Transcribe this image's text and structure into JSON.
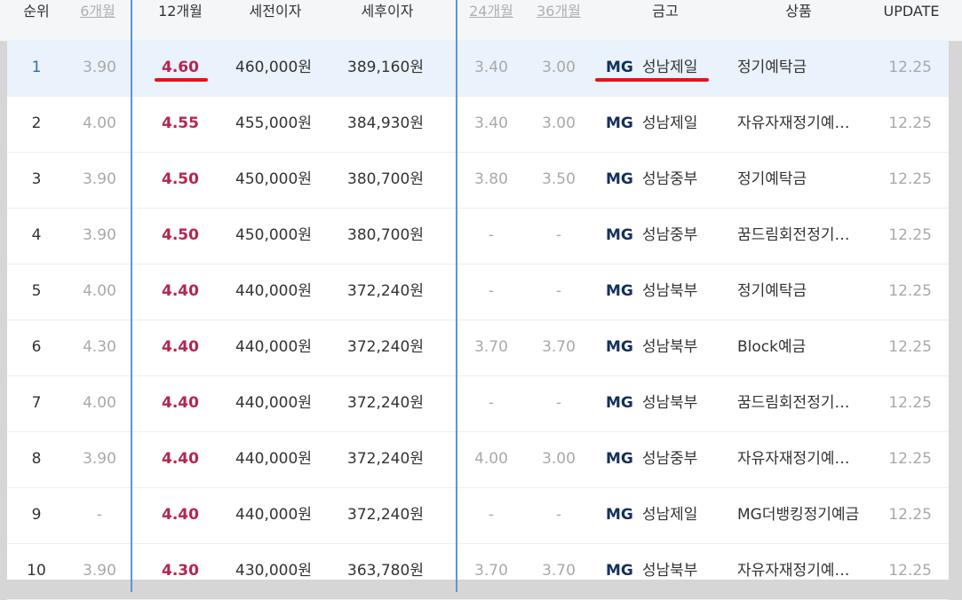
{
  "headers": {
    "rank": "순위",
    "m6": "6개월",
    "m12": "12개월",
    "pretax": "세전이자",
    "aftertax": "세후이자",
    "m24": "24개월",
    "m36": "36개월",
    "bank": "금고",
    "product": "상품",
    "update": "UPDATE"
  },
  "rows": [
    {
      "rank": "1",
      "m6": "3.90",
      "m12": "4.60",
      "pretax": "460,000원",
      "aftertax": "389,160원",
      "m24": "3.40",
      "m36": "3.00",
      "bank_prefix": "MG",
      "bank": "성남제일",
      "product": "정기예탁금",
      "update": "12.25"
    },
    {
      "rank": "2",
      "m6": "4.00",
      "m12": "4.55",
      "pretax": "455,000원",
      "aftertax": "384,930원",
      "m24": "3.40",
      "m36": "3.00",
      "bank_prefix": "MG",
      "bank": "성남제일",
      "product": "자유자재정기예…",
      "update": "12.25"
    },
    {
      "rank": "3",
      "m6": "3.90",
      "m12": "4.50",
      "pretax": "450,000원",
      "aftertax": "380,700원",
      "m24": "3.80",
      "m36": "3.50",
      "bank_prefix": "MG",
      "bank": "성남중부",
      "product": "정기예탁금",
      "update": "12.25"
    },
    {
      "rank": "4",
      "m6": "3.90",
      "m12": "4.50",
      "pretax": "450,000원",
      "aftertax": "380,700원",
      "m24": "-",
      "m36": "-",
      "bank_prefix": "MG",
      "bank": "성남중부",
      "product": "꿈드림회전정기…",
      "update": "12.25"
    },
    {
      "rank": "5",
      "m6": "4.00",
      "m12": "4.40",
      "pretax": "440,000원",
      "aftertax": "372,240원",
      "m24": "-",
      "m36": "-",
      "bank_prefix": "MG",
      "bank": "성남북부",
      "product": "정기예탁금",
      "update": "12.25"
    },
    {
      "rank": "6",
      "m6": "4.30",
      "m12": "4.40",
      "pretax": "440,000원",
      "aftertax": "372,240원",
      "m24": "3.70",
      "m36": "3.70",
      "bank_prefix": "MG",
      "bank": "성남북부",
      "product": "Block예금",
      "update": "12.25"
    },
    {
      "rank": "7",
      "m6": "4.00",
      "m12": "4.40",
      "pretax": "440,000원",
      "aftertax": "372,240원",
      "m24": "-",
      "m36": "-",
      "bank_prefix": "MG",
      "bank": "성남북부",
      "product": "꿈드림회전정기…",
      "update": "12.25"
    },
    {
      "rank": "8",
      "m6": "3.90",
      "m12": "4.40",
      "pretax": "440,000원",
      "aftertax": "372,240원",
      "m24": "4.00",
      "m36": "3.00",
      "bank_prefix": "MG",
      "bank": "성남중부",
      "product": "자유자재정기예…",
      "update": "12.25"
    },
    {
      "rank": "9",
      "m6": "-",
      "m12": "4.40",
      "pretax": "440,000원",
      "aftertax": "372,240원",
      "m24": "-",
      "m36": "-",
      "bank_prefix": "MG",
      "bank": "성남제일",
      "product": "MG더뱅킹정기예금",
      "update": "12.25"
    },
    {
      "rank": "10",
      "m6": "3.90",
      "m12": "4.30",
      "pretax": "430,000원",
      "aftertax": "363,780원",
      "m24": "3.70",
      "m36": "3.70",
      "bank_prefix": "MG",
      "bank": "성남북부",
      "product": "자유자재정기예…",
      "update": "12.25"
    }
  ],
  "colors": {
    "accent_line": "#5b95da",
    "rate_red": "#b5264e",
    "underline_red": "#e8121b",
    "highlight_row": "#eaf2fb"
  }
}
